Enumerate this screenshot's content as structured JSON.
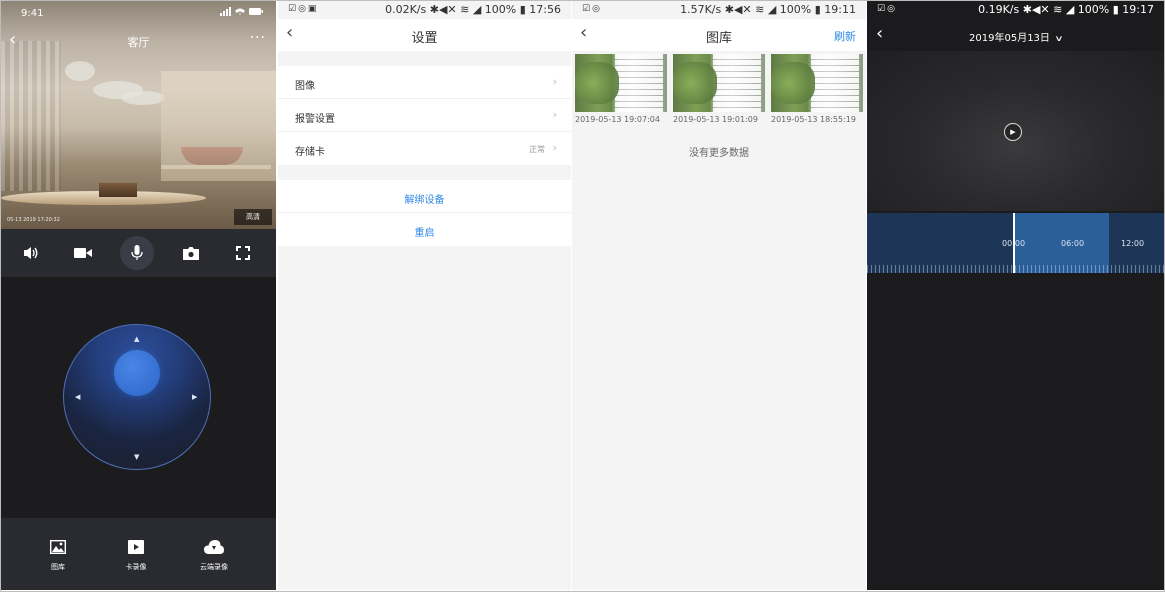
{
  "panel1": {
    "status_time": "9:41",
    "title": "客厅",
    "video_timestamp": "05-13 2019 17:20:32",
    "quality_badge": "高清",
    "bottom_tabs": [
      {
        "icon": "image-icon",
        "label": "图库"
      },
      {
        "icon": "video-play-icon",
        "label": "卡录像"
      },
      {
        "icon": "cloud-download-icon",
        "label": "云端录像"
      }
    ],
    "toolbar_icons": [
      "speaker-icon",
      "camera-record-icon",
      "microphone-icon",
      "snapshot-icon",
      "fullscreen-icon"
    ]
  },
  "panel2": {
    "status_speed": "0.02K/s",
    "status_battery": "100%",
    "status_time": "17:56",
    "title": "设置",
    "settings": [
      {
        "label": "图像",
        "value": ""
      },
      {
        "label": "报警设置",
        "value": ""
      },
      {
        "label": "存储卡",
        "value": "正常"
      }
    ],
    "actions": [
      "解绑设备",
      "重启"
    ]
  },
  "panel3": {
    "status_speed": "1.57K/s",
    "status_battery": "100%",
    "status_time": "19:11",
    "title": "图库",
    "refresh_label": "刷新",
    "photos": [
      {
        "caption": "2019-05-13 19:07:04"
      },
      {
        "caption": "2019-05-13 19:01:09"
      },
      {
        "caption": "2019-05-13 18:55:19"
      }
    ],
    "no_more": "没有更多数据"
  },
  "panel4": {
    "status_speed": "0.19K/s",
    "status_battery": "100%",
    "status_time": "19:17",
    "date": "2019年05月13日",
    "timeline_labels": [
      "00:00",
      "06:00",
      "12:00"
    ]
  }
}
